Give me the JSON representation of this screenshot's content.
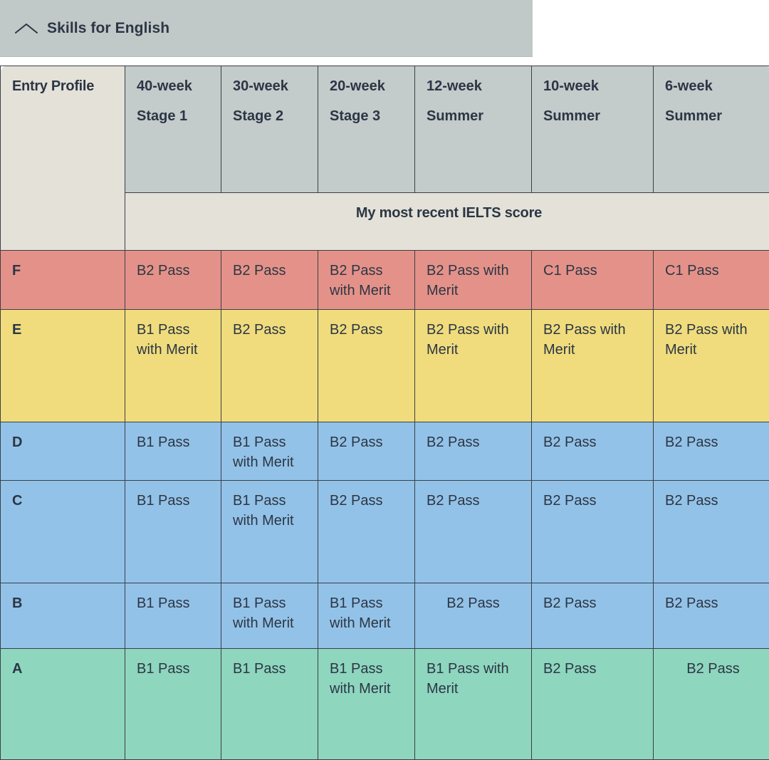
{
  "top_bar": {
    "icon": "chevron-up-icon",
    "title": "Skills for English"
  },
  "table": {
    "entry_profile_label": "Entry Profile",
    "banner_label": "My most recent IELTS score",
    "columns": [
      {
        "duration": "40-week",
        "stage": "Stage 1"
      },
      {
        "duration": "30-week",
        "stage": "Stage 2"
      },
      {
        "duration": "20-week",
        "stage": "Stage 3"
      },
      {
        "duration": "12-week",
        "stage": "Summer"
      },
      {
        "duration": "10-week",
        "stage": "Summer"
      },
      {
        "duration": "6-week",
        "stage": "Summer"
      }
    ],
    "rows": [
      {
        "label": "F",
        "color": "#e49289",
        "cells": [
          "B2 Pass",
          "B2 Pass",
          "B2 Pass with Merit",
          "B2 Pass with Merit",
          "C1 Pass",
          "C1 Pass"
        ]
      },
      {
        "label": "E",
        "color": "#f0dc7d",
        "cells": [
          "B1 Pass with Merit",
          "B2 Pass",
          "B2 Pass",
          "B2 Pass with Merit",
          "B2 Pass with Merit",
          "B2 Pass with Merit"
        ]
      },
      {
        "label": "D",
        "color": "#93c2e8",
        "cells": [
          "B1 Pass",
          "B1 Pass with Merit",
          "B2 Pass",
          "B2 Pass",
          "B2 Pass",
          "B2 Pass"
        ]
      },
      {
        "label": "C",
        "color": "#93c2e8",
        "cells": [
          "B1 Pass",
          "B1 Pass with Merit",
          "B2 Pass",
          "B2 Pass",
          "B2 Pass",
          "B2 Pass"
        ]
      },
      {
        "label": "B",
        "color": "#93c2e8",
        "cells": [
          "B1 Pass",
          "B1 Pass with Merit",
          "B1 Pass with Merit",
          "B2 Pass",
          "B2 Pass",
          "B2 Pass"
        ]
      },
      {
        "label": "A",
        "color": "#8ed6be",
        "cells": [
          "B1 Pass",
          "B1 Pass",
          "B1 Pass with Merit",
          "B1 Pass with Merit",
          "B2 Pass",
          "B2 Pass"
        ]
      }
    ]
  },
  "colors": {
    "top_bar_bg": "#c0c8c8",
    "header_bg": "#c3cbcb",
    "entry_bg": "#e3e1d8",
    "navy": "#1f2f6e",
    "ink": "#2c3644",
    "band_f": "#e49289",
    "band_e": "#f0dc7d",
    "band_blue": "#93c2e8",
    "band_a": "#8ed6be"
  }
}
